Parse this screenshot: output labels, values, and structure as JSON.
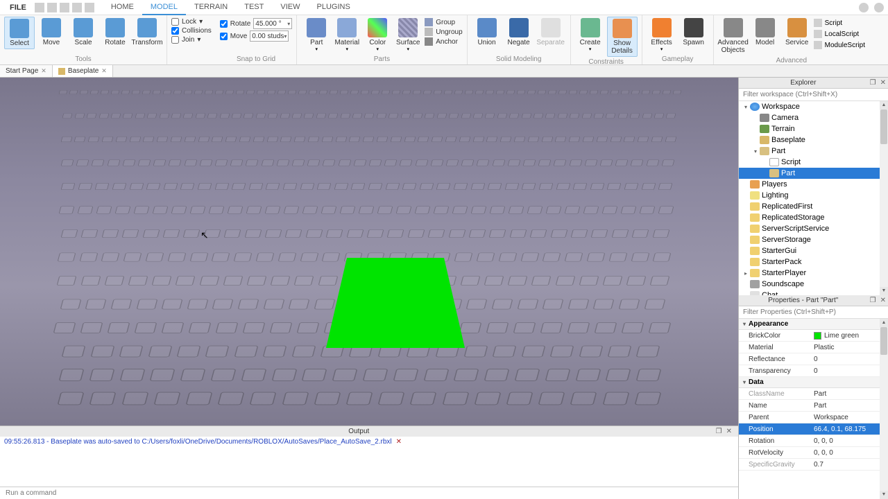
{
  "menubar": {
    "file": "FILE",
    "tabs": [
      "HOME",
      "MODEL",
      "TERRAIN",
      "TEST",
      "VIEW",
      "PLUGINS"
    ],
    "active_tab": 1
  },
  "ribbon": {
    "tools": {
      "label": "Tools",
      "buttons": [
        "Select",
        "Move",
        "Scale",
        "Rotate",
        "Transform"
      ],
      "lock": "Lock",
      "collisions": "Collisions",
      "join": "Join"
    },
    "snap": {
      "label": "Snap to Grid",
      "rotate": "Rotate",
      "rotate_val": "45.000 °",
      "move": "Move",
      "move_val": "0.00 studs"
    },
    "parts": {
      "label": "Parts",
      "buttons": [
        "Part",
        "Material",
        "Color",
        "Surface"
      ],
      "group": "Group",
      "ungroup": "Ungroup",
      "anchor": "Anchor"
    },
    "solid": {
      "label": "Solid Modeling",
      "buttons": [
        "Union",
        "Negate",
        "Separate"
      ]
    },
    "constraints": {
      "label": "Constraints",
      "create": "Create",
      "show": "Show Details"
    },
    "gameplay": {
      "label": "Gameplay",
      "effects": "Effects",
      "spawn": "Spawn"
    },
    "advanced": {
      "label": "Advanced",
      "adv": "Advanced Objects",
      "model": "Model",
      "service": "Service",
      "scripts": [
        "Script",
        "LocalScript",
        "ModuleScript"
      ]
    }
  },
  "doctabs": [
    {
      "label": "Start Page",
      "active": false
    },
    {
      "label": "Baseplate",
      "active": true
    }
  ],
  "output": {
    "title": "Output",
    "line": "09:55:26.813 - Baseplate was auto-saved to C:/Users/foxli/OneDrive/Documents/ROBLOX/AutoSaves/Place_AutoSave_2.rbxl"
  },
  "cmdbar": {
    "placeholder": "Run a command"
  },
  "explorer": {
    "title": "Explorer",
    "filter_ph": "Filter workspace (Ctrl+Shift+X)",
    "tree": [
      {
        "depth": 0,
        "arrow": "▾",
        "ico": "globe",
        "label": "Workspace"
      },
      {
        "depth": 1,
        "arrow": "",
        "ico": "cam",
        "label": "Camera"
      },
      {
        "depth": 1,
        "arrow": "",
        "ico": "terrain",
        "label": "Terrain"
      },
      {
        "depth": 1,
        "arrow": "",
        "ico": "baseplate",
        "label": "Baseplate"
      },
      {
        "depth": 1,
        "arrow": "▾",
        "ico": "part",
        "label": "Part"
      },
      {
        "depth": 2,
        "arrow": "",
        "ico": "script",
        "label": "Script"
      },
      {
        "depth": 2,
        "arrow": "",
        "ico": "part",
        "label": "Part",
        "selected": true
      },
      {
        "depth": 0,
        "arrow": "",
        "ico": "players",
        "label": "Players"
      },
      {
        "depth": 0,
        "arrow": "",
        "ico": "light",
        "label": "Lighting"
      },
      {
        "depth": 0,
        "arrow": "",
        "ico": "folder",
        "label": "ReplicatedFirst"
      },
      {
        "depth": 0,
        "arrow": "",
        "ico": "folder",
        "label": "ReplicatedStorage"
      },
      {
        "depth": 0,
        "arrow": "",
        "ico": "folder",
        "label": "ServerScriptService"
      },
      {
        "depth": 0,
        "arrow": "",
        "ico": "folder",
        "label": "ServerStorage"
      },
      {
        "depth": 0,
        "arrow": "",
        "ico": "folder",
        "label": "StarterGui"
      },
      {
        "depth": 0,
        "arrow": "",
        "ico": "folder",
        "label": "StarterPack"
      },
      {
        "depth": 0,
        "arrow": "▸",
        "ico": "folder",
        "label": "StarterPlayer"
      },
      {
        "depth": 0,
        "arrow": "",
        "ico": "sound",
        "label": "Soundscape"
      },
      {
        "depth": 0,
        "arrow": "",
        "ico": "chat",
        "label": "Chat"
      }
    ]
  },
  "properties": {
    "title": "Properties - Part \"Part\"",
    "filter_ph": "Filter Properties (Ctrl+Shift+P)",
    "sections": [
      {
        "name": "Appearance",
        "rows": [
          {
            "k": "BrickColor",
            "v": "Lime green",
            "swatch": "#00e400"
          },
          {
            "k": "Material",
            "v": "Plastic"
          },
          {
            "k": "Reflectance",
            "v": "0"
          },
          {
            "k": "Transparency",
            "v": "0"
          }
        ]
      },
      {
        "name": "Data",
        "rows": [
          {
            "k": "ClassName",
            "v": "Part",
            "dim": true
          },
          {
            "k": "Name",
            "v": "Part"
          },
          {
            "k": "Parent",
            "v": "Workspace"
          },
          {
            "k": "Position",
            "v": "66.4, 0.1, 68.175",
            "exp": true,
            "selected": true
          },
          {
            "k": "Rotation",
            "v": "0, 0, 0",
            "exp": true
          },
          {
            "k": "RotVelocity",
            "v": "0, 0, 0",
            "exp": true
          },
          {
            "k": "SpecificGravity",
            "v": "0.7",
            "dim": true
          }
        ]
      }
    ]
  }
}
